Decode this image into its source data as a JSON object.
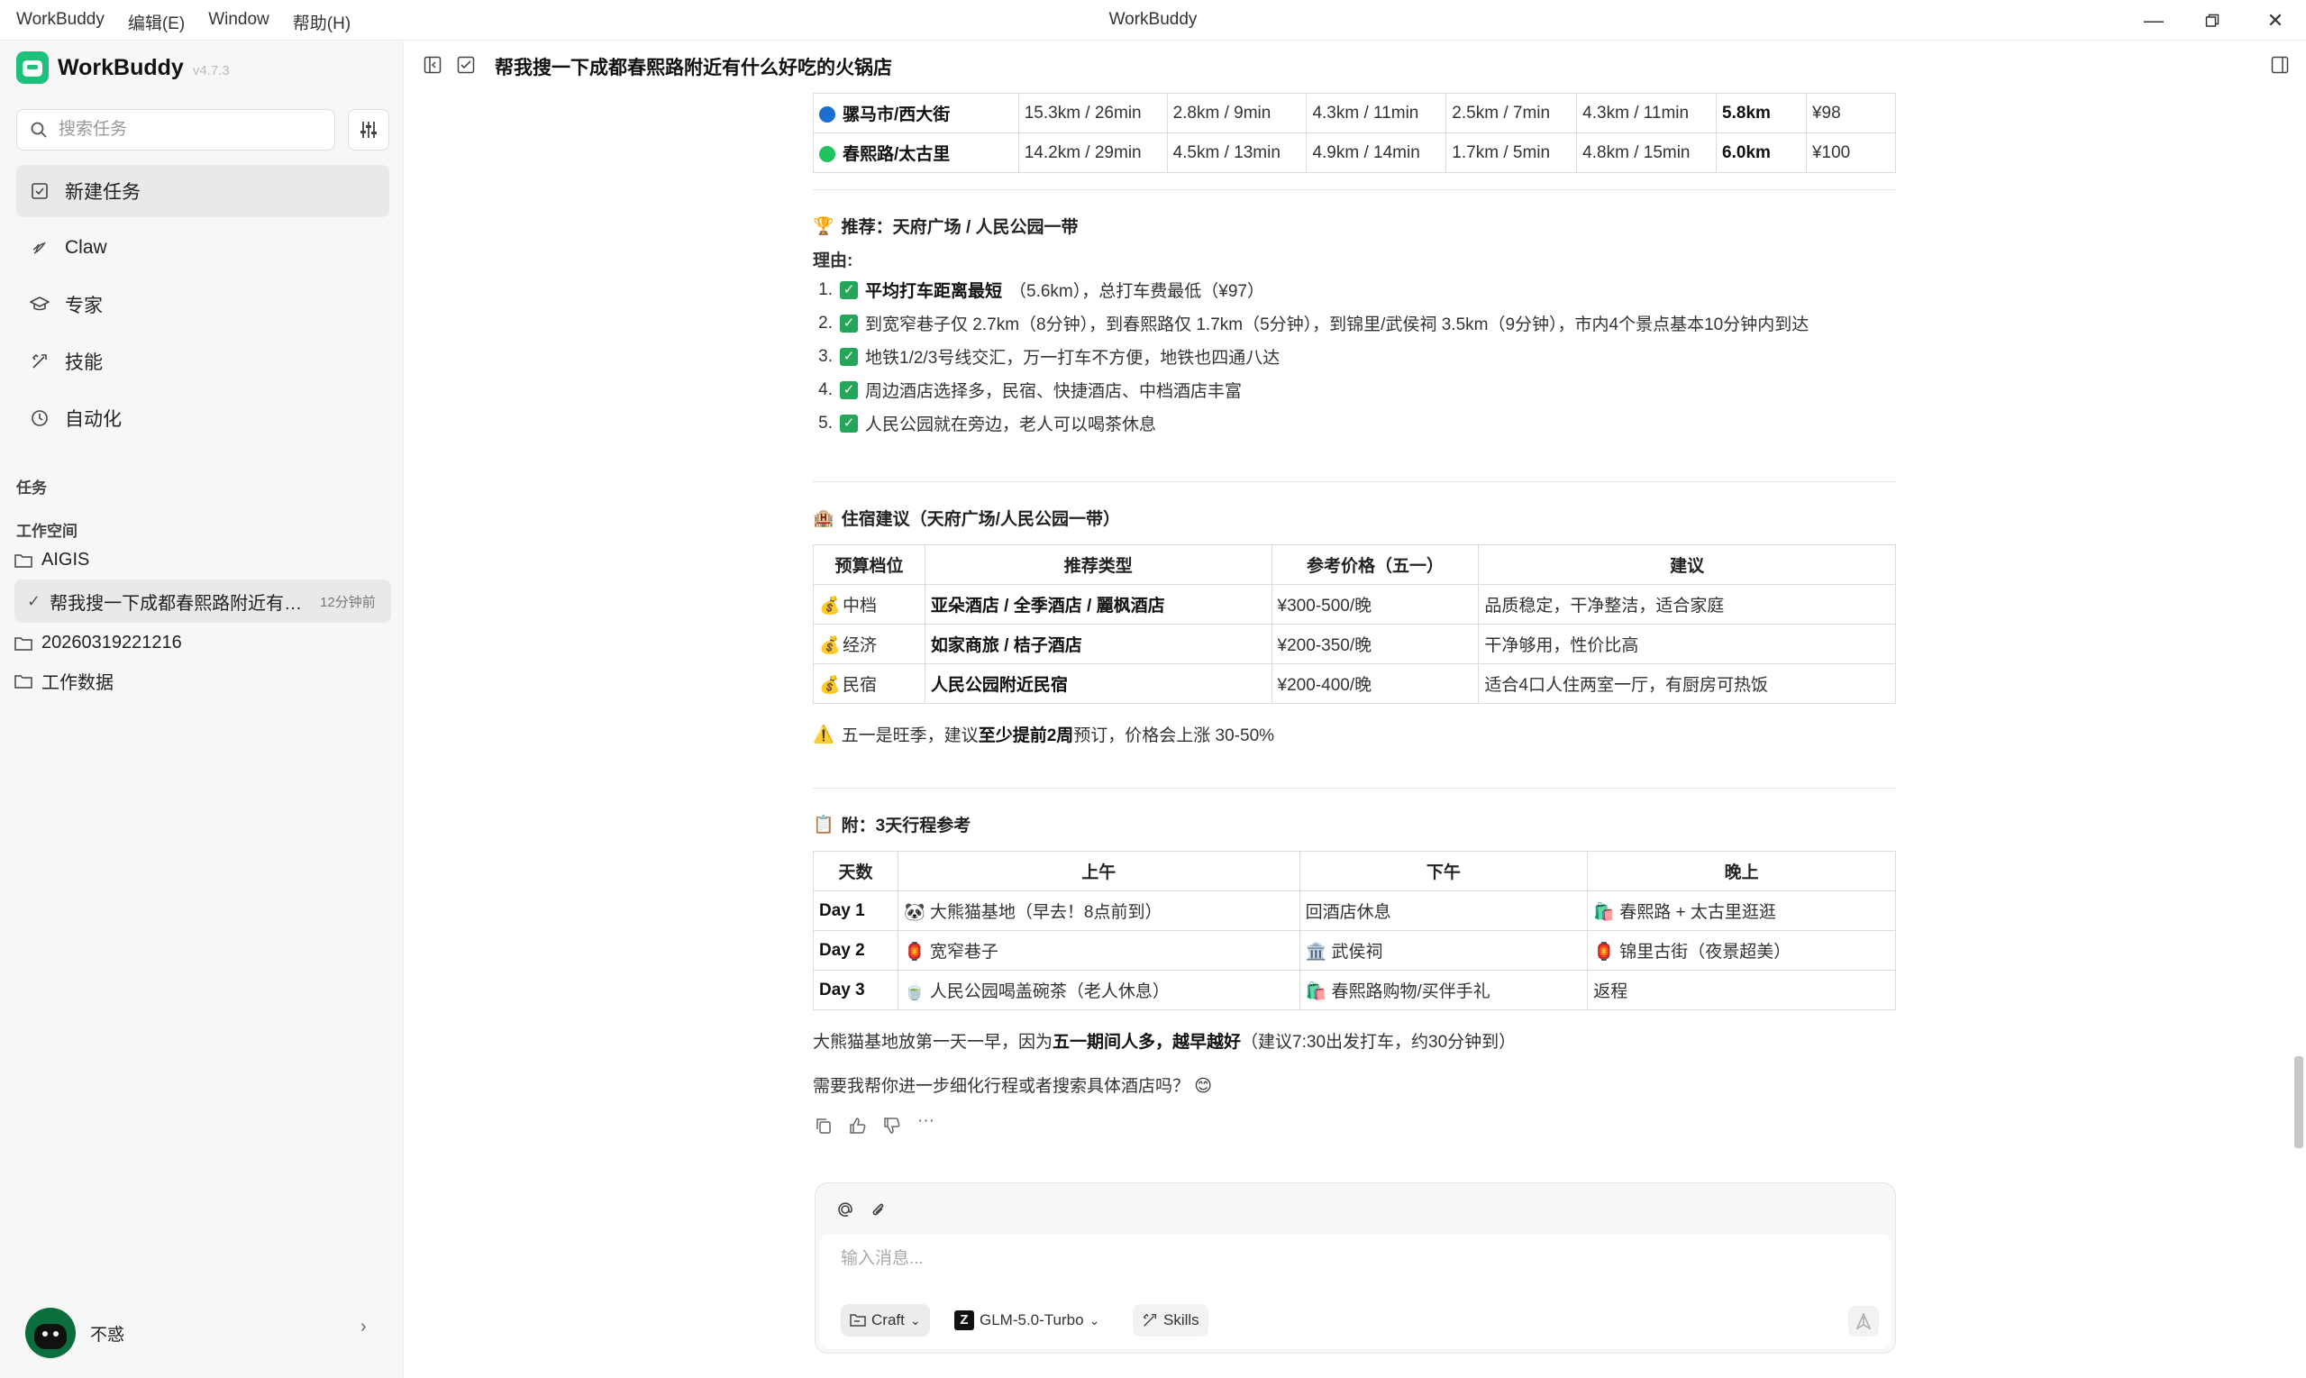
{
  "window": {
    "menu": [
      "WorkBuddy",
      "编辑(E)",
      "Window",
      "帮助(H)"
    ],
    "title": "WorkBuddy"
  },
  "sidebar": {
    "app_name": "WorkBuddy",
    "version": "v4.7.3",
    "search_placeholder": "搜索任务",
    "nav": [
      {
        "label": "新建任务",
        "icon": "new-task-icon"
      },
      {
        "label": "Claw",
        "icon": "claw-icon"
      },
      {
        "label": "专家",
        "icon": "expert-icon"
      },
      {
        "label": "技能",
        "icon": "skill-icon"
      },
      {
        "label": "自动化",
        "icon": "clock-icon"
      }
    ],
    "tasks_label": "任务",
    "workspace_label": "工作空间",
    "folders": [
      "AIGIS",
      "20260319221216",
      "工作数据"
    ],
    "active_task": {
      "title": "帮我搜一下成都春熙路附近有什么好吃的火锅店",
      "time": "12分钟前"
    },
    "user": "不惑"
  },
  "header": {
    "title": "帮我搜一下成都春熙路附近有什么好吃的火锅店"
  },
  "distance_table": {
    "rows": [
      {
        "name": "骡马市/西大街",
        "color": "#1a6fd1",
        "cells": [
          "15.3km / 26min",
          "2.8km / 9min",
          "4.3km / 11min",
          "2.5km / 7min",
          "4.3km / 11min"
        ],
        "avg": "5.8km",
        "price": "¥98"
      },
      {
        "name": "春熙路/太古里",
        "color": "#22c35e",
        "cells": [
          "14.2km / 29min",
          "4.5km / 13min",
          "4.9km / 14min",
          "1.7km / 5min",
          "4.8km / 15min"
        ],
        "avg": "6.0km",
        "price": "¥100"
      }
    ]
  },
  "recommend": {
    "heading": "推荐：天府广场 / 人民公园一带",
    "reason_label": "理由",
    "reasons": [
      {
        "bold": "平均打车距离最短",
        "text": "（5.6km），总打车费最低（¥97）"
      },
      {
        "bold": "",
        "text": "到宽窄巷子仅 2.7km（8分钟），到春熙路仅 1.7km（5分钟），到锦里/武侯祠 3.5km（9分钟），市内4个景点基本10分钟内到达"
      },
      {
        "bold": "",
        "text": "地铁1/2/3号线交汇，万一打车不方便，地铁也四通八达"
      },
      {
        "bold": "",
        "text": "周边酒店选择多，民宿、快捷酒店、中档酒店丰富"
      },
      {
        "bold": "",
        "text": "人民公园就在旁边，老人可以喝茶休息"
      }
    ]
  },
  "lodging": {
    "heading": "住宿建议（天府广场/人民公园一带）",
    "headers": [
      "预算档位",
      "推荐类型",
      "参考价格（五一）",
      "建议"
    ],
    "rows": [
      {
        "tier": "中档",
        "type": "亚朵酒店 / 全季酒店 / 麗枫酒店",
        "price": "¥300-500/晚",
        "advice": "品质稳定，干净整洁，适合家庭"
      },
      {
        "tier": "经济",
        "type": "如家商旅 / 桔子酒店",
        "price": "¥200-350/晚",
        "advice": "干净够用，性价比高"
      },
      {
        "tier": "民宿",
        "type": "人民公园附近民宿",
        "price": "¥200-400/晚",
        "advice": "适合4口人住两室一厅，有厨房可热饭"
      }
    ],
    "warning_pre": "五一是旺季，建议",
    "warning_bold": "至少提前2周",
    "warning_post": "预订，价格会上涨 30-50%"
  },
  "itinerary": {
    "heading": "附：3天行程参考",
    "headers": [
      "天数",
      "上午",
      "下午",
      "晚上"
    ],
    "rows": [
      {
        "day": "Day 1",
        "am": "🐼 大熊猫基地（早去！8点前到）",
        "pm": "回酒店休息",
        "eve": "🛍️ 春熙路 + 太古里逛逛"
      },
      {
        "day": "Day 2",
        "am": "🏮 宽窄巷子",
        "pm": "🏛️ 武侯祠",
        "eve": "🏮 锦里古街（夜景超美）"
      },
      {
        "day": "Day 3",
        "am": "🍵 人民公园喝盖碗茶（老人休息）",
        "pm": "🛍️ 春熙路购物/买伴手礼",
        "eve": "返程"
      }
    ],
    "note_pre": "大熊猫基地放第一天一早，因为",
    "note_bold": "五一期间人多，越早越好",
    "note_post": "（建议7:30出发打车，约30分钟到）",
    "followup": "需要我帮你进一步细化行程或者搜索具体酒店吗？ 😊"
  },
  "composer": {
    "placeholder": "输入消息...",
    "mode": "Craft",
    "model": "GLM-5.0-Turbo",
    "skills": "Skills"
  }
}
